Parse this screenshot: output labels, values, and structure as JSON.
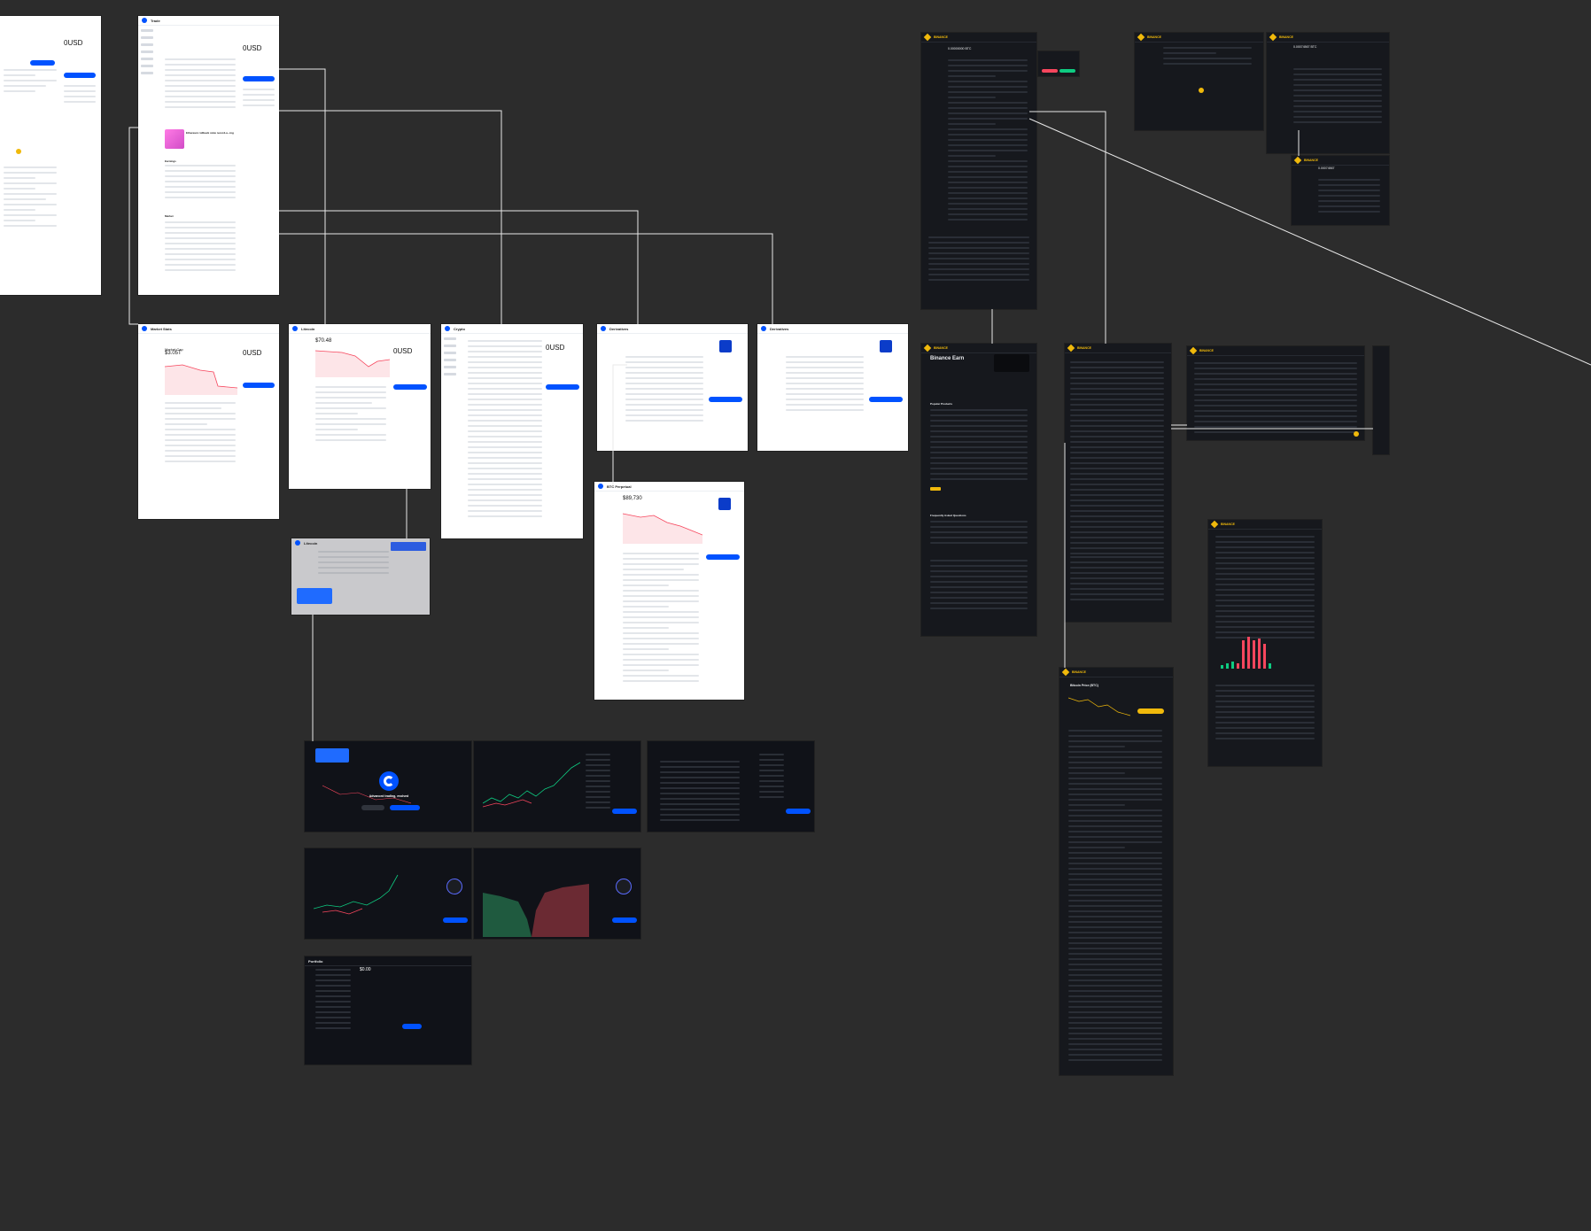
{
  "boards": {
    "coinbase_home": {
      "title": "",
      "balance": "0USD"
    },
    "trade": {
      "title": "Trade",
      "balance": "0USD",
      "nft_headline": "Ethereum rollback stole record-a...ing",
      "sections": [
        "Earnings",
        "Market"
      ]
    },
    "market_stats": {
      "title": "Market Stats",
      "market_cap_label": "Market Cap",
      "market_cap_value": "$3.05T",
      "balance": "0USD"
    },
    "litecoin": {
      "title": "Litecoin",
      "price": "$70.48",
      "balance": "0USD"
    },
    "crypto": {
      "title": "Crypto",
      "balance": "0USD"
    },
    "derivatives_1": {
      "title": "Derivatives"
    },
    "derivatives_2": {
      "title": "Derivatives"
    },
    "btc_perpetual": {
      "title": "BTC Perpetual",
      "price": "$89,730"
    },
    "litecoin_dim": {
      "title": "Litecoin"
    },
    "adv_trade_modal": {
      "headline": "Advanced trading, evolved"
    },
    "portfolio": {
      "title": "Portfolio",
      "balance": "$0.00"
    },
    "binance_top": {
      "brand": "BINANCE",
      "balance": "0.00000000 BTC"
    },
    "binance_wallet": {
      "brand": "BINANCE"
    },
    "binance_assets": {
      "brand": "BINANCE",
      "balance": "0.00074567 BTC"
    },
    "binance_assets_2": {
      "brand": "BINANCE",
      "balance": "0.00074567"
    },
    "binance_earn": {
      "brand": "BINANCE",
      "title": "Binance Earn",
      "sections": [
        "Popular Products",
        "Frequently Asked Questions"
      ]
    },
    "binance_markets": {
      "brand": "BINANCE"
    },
    "binance_orders": {
      "brand": "BINANCE"
    },
    "binance_overview": {
      "brand": "BINANCE"
    },
    "binance_price": {
      "brand": "BINANCE",
      "title": "Bitcoin Price (BTC)"
    }
  },
  "colors": {
    "canvas": "#2c2c2c",
    "coinbase_blue": "#0052ff",
    "binance_yellow": "#f0b90b",
    "up_green": "#0ecb81",
    "down_red": "#f6465d"
  }
}
